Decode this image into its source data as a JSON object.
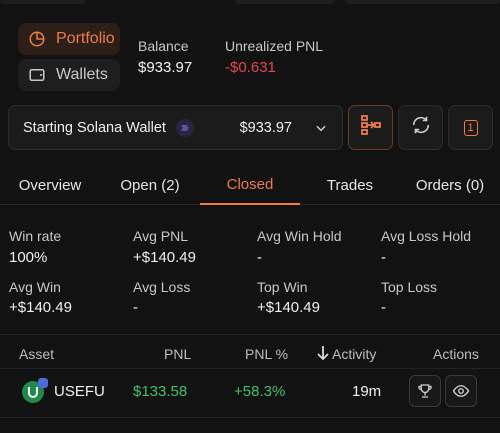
{
  "nav": {
    "portfolio_label": "Portfolio",
    "wallets_label": "Wallets"
  },
  "summary": {
    "balance_label": "Balance",
    "balance_value": "$933.97",
    "upnl_label": "Unrealized PNL",
    "upnl_value": "-$0.631"
  },
  "wallet": {
    "name": "Starting Solana Wallet",
    "amount": "$933.97",
    "badge_count": "1"
  },
  "tabs": [
    {
      "label": "Overview"
    },
    {
      "label": "Open (2)"
    },
    {
      "label": "Closed"
    },
    {
      "label": "Trades"
    },
    {
      "label": "Orders (0)"
    }
  ],
  "stats": [
    {
      "label": "Win rate",
      "value": "100%",
      "tone": "white"
    },
    {
      "label": "Avg PNL",
      "value": "+$140.49",
      "tone": "green"
    },
    {
      "label": "Avg Win Hold",
      "value": "-",
      "tone": "white"
    },
    {
      "label": "Avg Loss Hold",
      "value": "-",
      "tone": "white"
    },
    {
      "label": "Avg Win",
      "value": "+$140.49",
      "tone": "green"
    },
    {
      "label": "Avg Loss",
      "value": "-",
      "tone": "white"
    },
    {
      "label": "Top Win",
      "value": "+$140.49",
      "tone": "green"
    },
    {
      "label": "Top Loss",
      "value": "-",
      "tone": "white"
    }
  ],
  "table": {
    "headers": {
      "asset": "Asset",
      "pnl": "PNL",
      "pnl_pct": "PNL %",
      "activity": "Activity",
      "actions": "Actions"
    },
    "rows": [
      {
        "asset": "USEFU",
        "pnl": "$133.58",
        "pnl_pct": "+58.3%",
        "activity": "19m"
      }
    ]
  },
  "colors": {
    "accent": "#f07b44",
    "positive": "#3fc16b",
    "negative": "#e3484f",
    "background": "#121212"
  },
  "icons": [
    "pie-chart-icon",
    "wallet-icon",
    "solana-icon",
    "chevron-down-icon",
    "hierarchy-icon",
    "refresh-icon",
    "trophy-icon",
    "eye-icon",
    "sort-down-icon"
  ]
}
